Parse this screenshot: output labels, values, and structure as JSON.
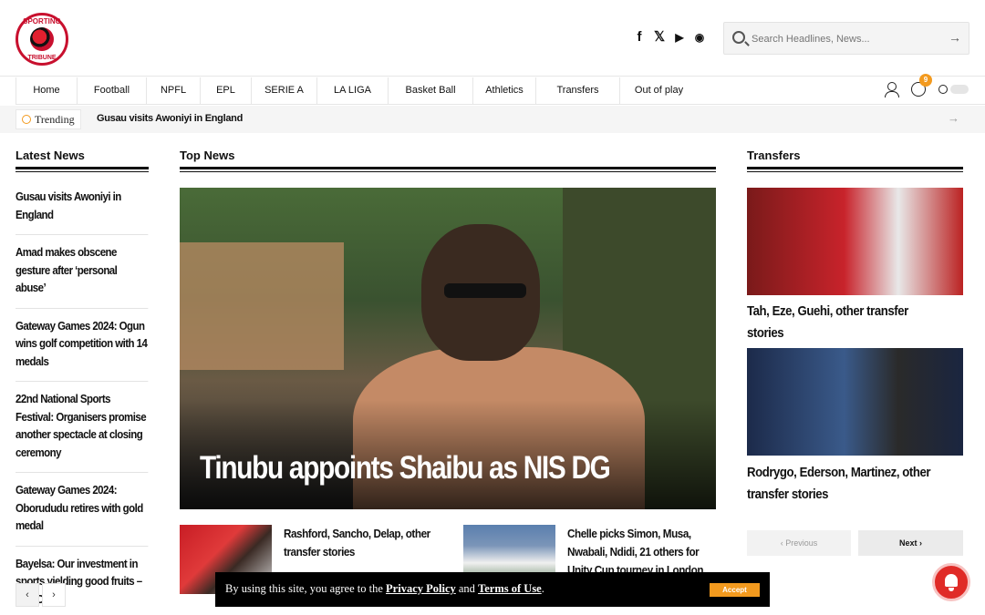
{
  "header": {
    "logo_top": "SPORTING",
    "logo_bottom": "TRIBUNE",
    "social": [
      "f",
      "𝕏",
      "▶",
      "◉"
    ],
    "search_placeholder": "Search Headlines, News..."
  },
  "nav": {
    "items": [
      "Home",
      "Football",
      "NPFL",
      "EPL",
      "SERIE A",
      "LA LIGA",
      "Basket Ball",
      "Athletics",
      "Transfers",
      "Out of play"
    ],
    "comment_count": "9"
  },
  "trending": {
    "label": "Trending",
    "headline": "Gusau visits Awoniyi in England"
  },
  "latest": {
    "heading": "Latest News",
    "items": [
      "Gusau visits Awoniyi in England",
      "Amad makes obscene gesture after ‘personal abuse’",
      "Gateway Games 2024: Ogun wins golf competition with 14 medals",
      "22nd National Sports Festival: Organisers promise another spectacle at closing ceremony",
      "Gateway Games 2024: Oborududu retires with gold medal",
      "Bayelsa: Our investment in sports yielding good fruits – Gov Diri"
    ],
    "prev": "‹",
    "next": "›"
  },
  "top": {
    "heading": "Top News",
    "hero_title": "Tinubu appoints Shaibu as NIS DG",
    "cards": [
      "Rashford, Sancho, Delap, other transfer stories",
      "Chelle picks Simon, Musa, Nwabali, Ndidi, 21 others for Unity Cup tourney in London"
    ]
  },
  "transfers": {
    "heading": "Transfers",
    "items": [
      "Tah, Eze, Guehi, other transfer stories",
      "Rodrygo, Ederson, Martinez, other transfer stories"
    ],
    "prev": "‹ Previous",
    "next": "Next ›"
  },
  "cookie": {
    "pre": "By using this site, you agree to the ",
    "privacy": "Privacy Policy",
    "and": " and ",
    "terms": "Terms of Use",
    "end": ".",
    "accept": "Accept"
  }
}
